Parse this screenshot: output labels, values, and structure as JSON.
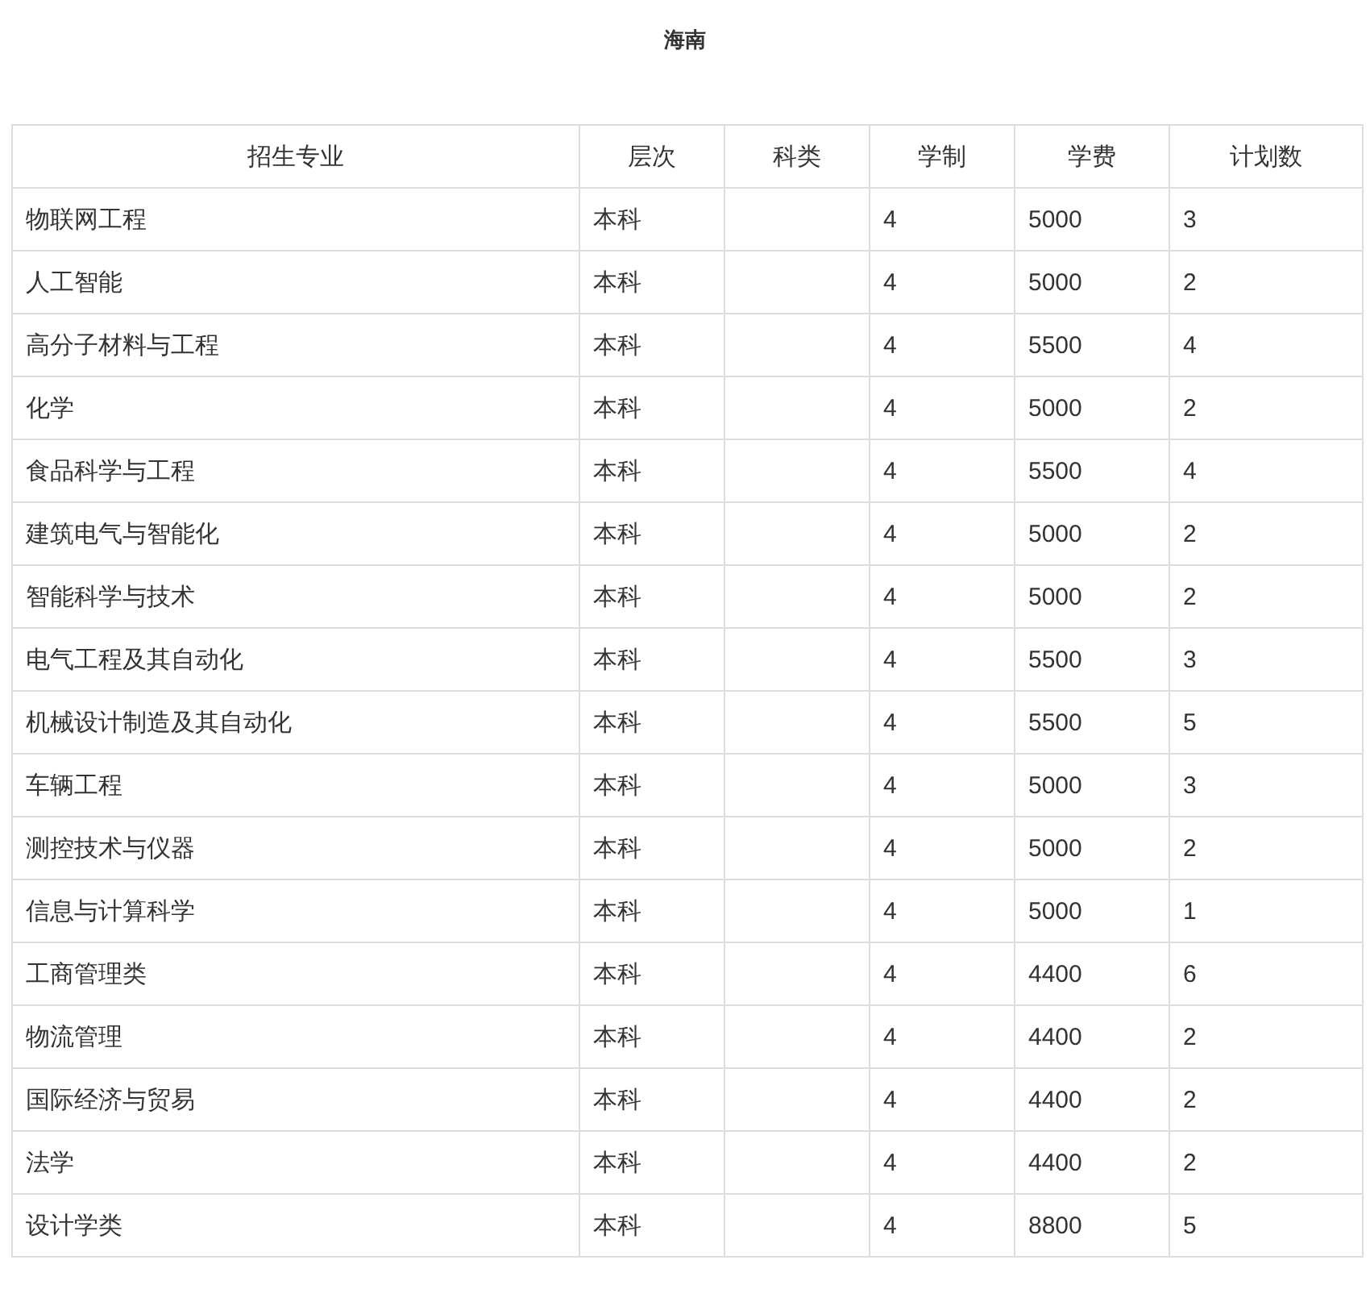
{
  "title": "海南",
  "table": {
    "columns": [
      "招生专业",
      "层次",
      "科类",
      "学制",
      "学费",
      "计划数"
    ],
    "rows": [
      [
        "物联网工程",
        "本科",
        "",
        "4",
        "5000",
        "3"
      ],
      [
        "人工智能",
        "本科",
        "",
        "4",
        "5000",
        "2"
      ],
      [
        "高分子材料与工程",
        "本科",
        "",
        "4",
        "5500",
        "4"
      ],
      [
        "化学",
        "本科",
        "",
        "4",
        "5000",
        "2"
      ],
      [
        "食品科学与工程",
        "本科",
        "",
        "4",
        "5500",
        "4"
      ],
      [
        "建筑电气与智能化",
        "本科",
        "",
        "4",
        "5000",
        "2"
      ],
      [
        "智能科学与技术",
        "本科",
        "",
        "4",
        "5000",
        "2"
      ],
      [
        "电气工程及其自动化",
        "本科",
        "",
        "4",
        "5500",
        "3"
      ],
      [
        "机械设计制造及其自动化",
        "本科",
        "",
        "4",
        "5500",
        "5"
      ],
      [
        "车辆工程",
        "本科",
        "",
        "4",
        "5000",
        "3"
      ],
      [
        "测控技术与仪器",
        "本科",
        "",
        "4",
        "5000",
        "2"
      ],
      [
        "信息与计算科学",
        "本科",
        "",
        "4",
        "5000",
        "1"
      ],
      [
        "工商管理类",
        "本科",
        "",
        "4",
        "4400",
        "6"
      ],
      [
        "物流管理",
        "本科",
        "",
        "4",
        "4400",
        "2"
      ],
      [
        "国际经济与贸易",
        "本科",
        "",
        "4",
        "4400",
        "2"
      ],
      [
        "法学",
        "本科",
        "",
        "4",
        "4400",
        "2"
      ],
      [
        "设计学类",
        "本科",
        "",
        "4",
        "8800",
        "5"
      ]
    ]
  }
}
